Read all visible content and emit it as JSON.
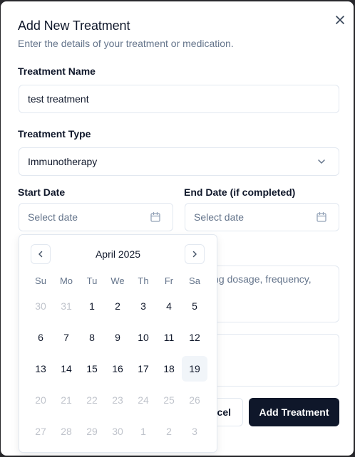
{
  "dialog": {
    "title": "Add New Treatment",
    "subtitle": "Enter the details of your treatment or medication.",
    "close_icon": "close-icon"
  },
  "form": {
    "name_label": "Treatment Name",
    "name_value": "test treatment",
    "type_label": "Treatment Type",
    "type_value": "Immunotherapy",
    "start_label": "Start Date",
    "start_placeholder": "Select date",
    "end_label": "End Date (if completed)",
    "end_placeholder": "Select date",
    "notes_placeholder_visible": "ing dosage, frequency,"
  },
  "buttons": {
    "cancel_visible": "ncel",
    "submit": "Add Treatment"
  },
  "calendar": {
    "month": "April 2025",
    "weekdays": [
      "Su",
      "Mo",
      "Tu",
      "We",
      "Th",
      "Fr",
      "Sa"
    ],
    "weeks": [
      [
        {
          "d": "30",
          "out": true
        },
        {
          "d": "31",
          "out": true
        },
        {
          "d": "1"
        },
        {
          "d": "2"
        },
        {
          "d": "3"
        },
        {
          "d": "4"
        },
        {
          "d": "5"
        }
      ],
      [
        {
          "d": "6"
        },
        {
          "d": "7"
        },
        {
          "d": "8"
        },
        {
          "d": "9"
        },
        {
          "d": "10"
        },
        {
          "d": "11"
        },
        {
          "d": "12"
        }
      ],
      [
        {
          "d": "13"
        },
        {
          "d": "14"
        },
        {
          "d": "15"
        },
        {
          "d": "16"
        },
        {
          "d": "17"
        },
        {
          "d": "18"
        },
        {
          "d": "19",
          "today": true
        }
      ],
      [
        {
          "d": "20",
          "out": true
        },
        {
          "d": "21",
          "out": true
        },
        {
          "d": "22",
          "out": true
        },
        {
          "d": "23",
          "out": true
        },
        {
          "d": "24",
          "out": true
        },
        {
          "d": "25",
          "out": true
        },
        {
          "d": "26",
          "out": true
        }
      ],
      [
        {
          "d": "27",
          "out": true
        },
        {
          "d": "28",
          "out": true
        },
        {
          "d": "29",
          "out": true
        },
        {
          "d": "30",
          "out": true
        },
        {
          "d": "1",
          "out": true
        },
        {
          "d": "2",
          "out": true
        },
        {
          "d": "3",
          "out": true
        }
      ]
    ]
  },
  "colors": {
    "primary": "#0f172a",
    "muted_text": "#64748b",
    "border": "#e2e8f0",
    "today_bg": "#f1f5f9"
  }
}
